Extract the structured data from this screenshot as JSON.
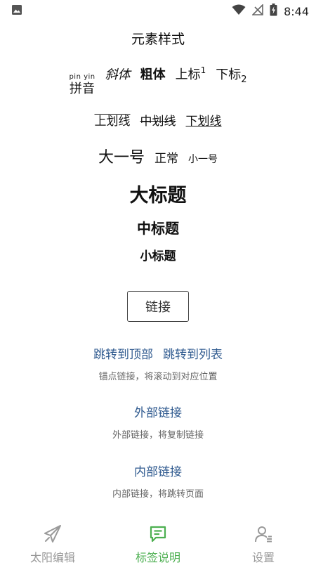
{
  "status_bar": {
    "time": "8:44"
  },
  "app_bar": {
    "title": "元素样式"
  },
  "samples": {
    "pinyin": {
      "ruby": "pin yin",
      "base": "拼音"
    },
    "italic": "斜体",
    "bold": "粗体",
    "superscript": {
      "base": "上标",
      "mark": "1"
    },
    "subscript": {
      "base": "下标",
      "mark": "2"
    },
    "overline": "上划线",
    "strikethrough": "中划线",
    "underline": "下划线",
    "size_large": "大一号",
    "size_normal": "正常",
    "size_small": "小一号",
    "heading_large": "大标题",
    "heading_medium": "中标题",
    "heading_small": "小标题"
  },
  "link_button": {
    "label": "链接"
  },
  "links": {
    "anchor_top": "跳转到顶部",
    "anchor_list": "跳转到列表",
    "anchor_caption": "锚点链接，将滚动到对应位置",
    "external": "外部链接",
    "external_caption": "外部链接，将复制链接",
    "internal": "内部链接",
    "internal_caption": "内部链接，将跳转页面"
  },
  "bottom_nav": {
    "items": [
      {
        "label": "太阳编辑",
        "icon": "paper-plane-icon",
        "active": false
      },
      {
        "label": "标签说明",
        "icon": "message-square-icon",
        "active": true
      },
      {
        "label": "设置",
        "icon": "user-settings-icon",
        "active": false
      }
    ]
  },
  "colors": {
    "accent": "#4caf50",
    "link": "#2f5a8f",
    "inactive": "#999999"
  }
}
